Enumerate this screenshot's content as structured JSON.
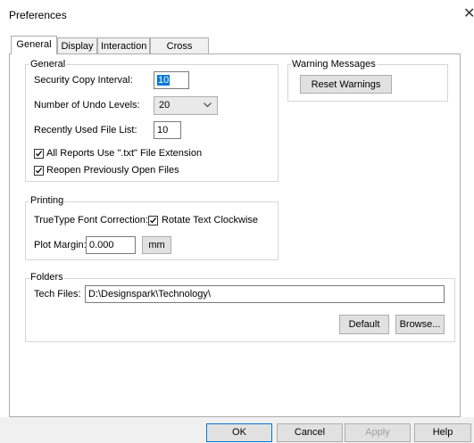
{
  "window": {
    "title": "Preferences",
    "close_glyph": "✕"
  },
  "tabs": [
    {
      "label": "General"
    },
    {
      "label": "Display"
    },
    {
      "label": "Interaction"
    },
    {
      "label": "Cross Probe"
    }
  ],
  "general_group": {
    "title": "General",
    "security_copy": {
      "label": "Security Copy Interval:",
      "value": "10"
    },
    "undo_levels": {
      "label": "Number of Undo Levels:",
      "value": "20"
    },
    "recent_files": {
      "label": "Recently Used File List:",
      "value": "10"
    },
    "reports_txt": {
      "label": "All Reports Use \".txt\" File Extension",
      "checked": true
    },
    "reopen_files": {
      "label": "Reopen Previously Open Files",
      "checked": true
    }
  },
  "warning_group": {
    "title": "Warning Messages",
    "reset_label": "Reset Warnings"
  },
  "printing_group": {
    "title": "Printing",
    "truetype_label": "TrueType Font Correction:",
    "rotate_label": "Rotate Text Clockwise",
    "rotate_checked": true,
    "plot_margin_label": "Plot Margin:",
    "plot_margin_value": "0.000",
    "units_label": "mm"
  },
  "folders_group": {
    "title": "Folders",
    "tech_files_label": "Tech Files:",
    "tech_files_value": "D:\\Designspark\\Technology\\",
    "default_label": "Default",
    "browse_label": "Browse..."
  },
  "footer": {
    "ok_label": "OK",
    "cancel_label": "Cancel",
    "apply_label": "Apply",
    "help_label": "Help"
  }
}
